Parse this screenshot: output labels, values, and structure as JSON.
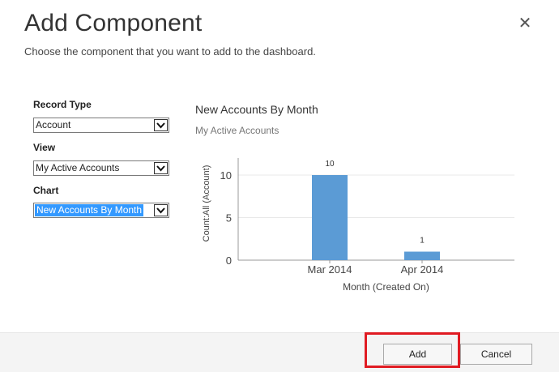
{
  "dialog": {
    "title": "Add Component",
    "subtitle": "Choose the component that you want to add to the dashboard.",
    "close_glyph": "✕"
  },
  "form": {
    "record_type_label": "Record Type",
    "record_type_value": "Account",
    "view_label": "View",
    "view_value": "My Active Accounts",
    "chart_label": "Chart",
    "chart_value": "New Accounts By Month"
  },
  "preview": {
    "title": "New Accounts By Month",
    "subtitle": "My Active Accounts"
  },
  "chart_data": {
    "type": "bar",
    "categories": [
      "Mar 2014",
      "Apr 2014"
    ],
    "values": [
      10,
      1
    ],
    "data_labels": [
      "10",
      "1"
    ],
    "xlabel": "Month (Created On)",
    "ylabel": "Count:All (Account)",
    "ylim": [
      0,
      12
    ],
    "yticks": [
      "0",
      "5",
      "10"
    ],
    "ytick_values": [
      0,
      5,
      10
    ],
    "grid": true,
    "bar_color": "#5b9bd5"
  },
  "footer": {
    "add_label": "Add",
    "cancel_label": "Cancel"
  },
  "colors": {
    "highlight": "#e01b22",
    "selection": "#3399ff"
  }
}
